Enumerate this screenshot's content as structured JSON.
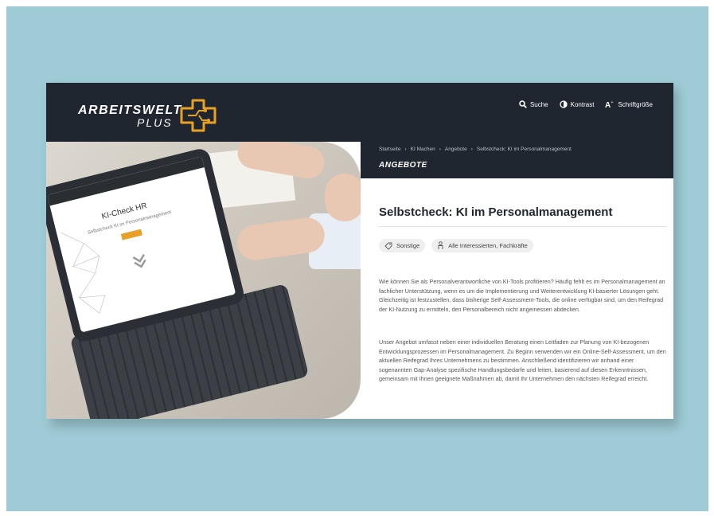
{
  "logo": {
    "line1": "ARBEITSWELT",
    "line2": "PLUS"
  },
  "header_tools": [
    {
      "icon": "search-icon",
      "label": "Suche"
    },
    {
      "icon": "contrast-icon",
      "label": "Kontrast"
    },
    {
      "icon": "font-size-icon",
      "label": "Schriftgröße"
    }
  ],
  "breadcrumb": [
    "Startseite",
    "›",
    "KI Machen",
    "›",
    "Angebote",
    "›",
    "Selbstcheck: KI im Personalmanagement"
  ],
  "section_label": "ANGEBOTE",
  "hero_screen": {
    "title": "KI-Check HR",
    "subtitle": "Selbstcheck KI im Personalmanagement"
  },
  "page_title": "Selbstcheck: KI im Personalmanagement",
  "tags": [
    {
      "icon": "tag-icon",
      "label": "Sonstige"
    },
    {
      "icon": "person-icon",
      "label": "Alle Interessierten, Fachkräfte"
    }
  ],
  "paragraphs": [
    "Wie können Sie als Personalverantwortliche von KI-Tools profitieren? Häufig fehlt es im Personalmanagement an fachlicher Unterstützung, wenn es um die Implementierung und Weiterentwicklung KI-basierter Lösungen geht. Gleichzeitig ist festzustellen, dass bisherige Self-Assessment-Tools, die online verfügbar sind, um den Reifegrad der KI-Nutzung zu ermitteln, den Personalbereich nicht angemessen abdecken.",
    "Unser Angebot umfasst neben einer individuellen Beratung einen Leitfaden zur Planung von KI-bezogenen Entwicklungsprozessen im Personalmanagement. Zu Beginn verwenden wir ein Online-Self-Assessment, um den aktuellen Reifegrad Ihres Unternehmens zu bestimmen. Anschließend identifizieren wir anhand einer sogenannten Gap-Analyse spezifische Handlungsbedarfe und leiten, basierend auf diesen Erkenntnissen, gemeinsam mit Ihnen geeignete Maßnahmen ab, damit Ihr Unternehmen den nächsten Reifegrad erreicht."
  ],
  "colors": {
    "header": "#1f2630",
    "backdrop": "#9ecbd6",
    "accent": "#e8a126"
  }
}
